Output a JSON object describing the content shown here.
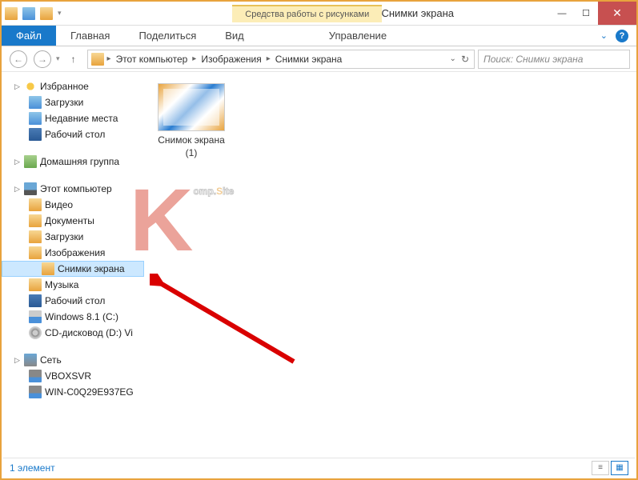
{
  "titlebar": {
    "context_tab": "Средства работы с рисунками",
    "window_title": "Снимки экрана"
  },
  "ribbon": {
    "file": "Файл",
    "tabs": [
      "Главная",
      "Поделиться",
      "Вид"
    ],
    "manage": "Управление"
  },
  "breadcrumb": {
    "items": [
      "Этот компьютер",
      "Изображения",
      "Снимки экрана"
    ]
  },
  "search": {
    "placeholder": "Поиск: Снимки экрана"
  },
  "sidebar": {
    "favorites": {
      "label": "Избранное",
      "items": [
        "Загрузки",
        "Недавние места",
        "Рабочий стол"
      ]
    },
    "homegroup": {
      "label": "Домашняя группа"
    },
    "computer": {
      "label": "Этот компьютер",
      "items": [
        "Видео",
        "Документы",
        "Загрузки",
        "Изображения"
      ],
      "selected": "Снимки экрана",
      "items2": [
        "Музыка",
        "Рабочий стол",
        "Windows 8.1 (C:)",
        "CD-дисковод (D:) Vi"
      ]
    },
    "network": {
      "label": "Сеть",
      "items": [
        "VBOXSVR",
        "WIN-C0Q29E937EG"
      ]
    }
  },
  "content": {
    "file_name": "Снимок экрана (1)"
  },
  "watermark": {
    "k": "K",
    "omp": "omp.",
    "s": "S",
    "ite": "ite"
  },
  "status": {
    "count": "1 элемент"
  }
}
